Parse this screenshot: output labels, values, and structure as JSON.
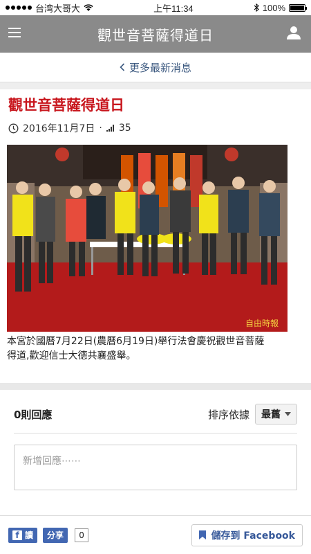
{
  "status": {
    "carrier": "台湾大哥大",
    "time": "上午11:34",
    "battery": "100%",
    "battery_level": 1.0
  },
  "nav": {
    "title": "觀世音菩薩得道日"
  },
  "back_link": {
    "label": "更多最新消息"
  },
  "article": {
    "title": "觀世音菩薩得道日",
    "date": "2016年11月7日",
    "views": "35",
    "caption": "本宮於國曆7月22日(農曆6月19日)舉行法會慶祝觀世音菩薩得道,歡迎信士大德共襄盛舉。",
    "photo_watermark": "自由時報"
  },
  "comments": {
    "count_label": "0則回應",
    "sort_label": "排序依據",
    "sort_value": "最舊",
    "placeholder": "新增回應⋯⋯"
  },
  "bottom": {
    "fb_read": "讀",
    "fb_share": "分享",
    "share_count": "0",
    "save_label": "儲存到 Facebook"
  },
  "colors": {
    "nav_bg": "#8a8a8a",
    "title_red": "#c8161d",
    "fb_blue": "#4267b2",
    "link_blue": "#3d5a80"
  }
}
